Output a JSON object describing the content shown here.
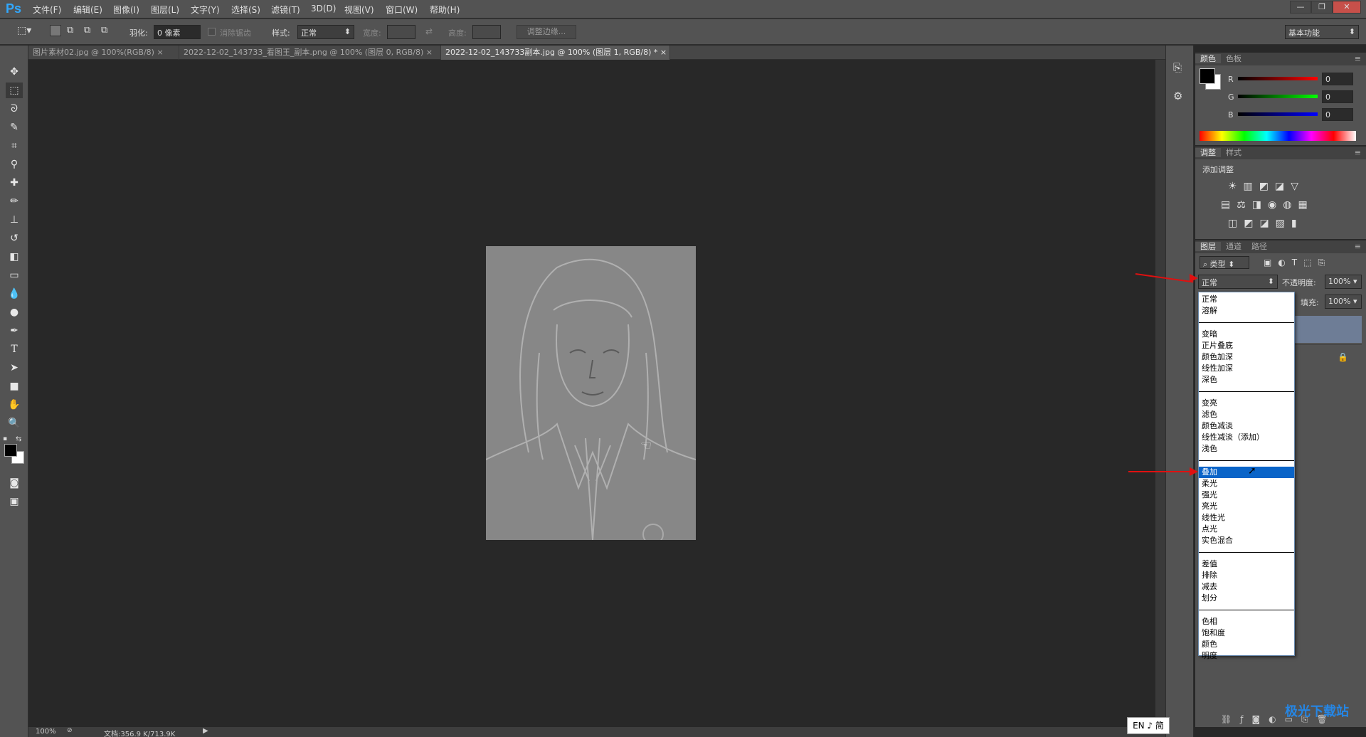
{
  "app": {
    "logo": "Ps"
  },
  "menu": [
    "文件(F)",
    "编辑(E)",
    "图像(I)",
    "图层(L)",
    "文字(Y)",
    "选择(S)",
    "滤镜(T)",
    "3D(D)",
    "视图(V)",
    "窗口(W)",
    "帮助(H)"
  ],
  "options": {
    "feather_label": "羽化:",
    "feather_value": "0 像素",
    "antialias_label": "消除锯齿",
    "style_label": "样式:",
    "style_value": "正常",
    "width_label": "宽度:",
    "height_label": "高度:",
    "refine_edge": "调整边缘...",
    "workspace": "基本功能"
  },
  "tabs": [
    {
      "label": "图片素材02.jpg @ 100%(RGB/8)",
      "close": "×"
    },
    {
      "label": "2022-12-02_143733_看图王_副本.png @ 100% (图层 0, RGB/8)",
      "close": "×"
    },
    {
      "label": "2022-12-02_143733副本.jpg @ 100% (图层 1, RGB/8) *",
      "close": "×"
    }
  ],
  "status": {
    "zoom": "100%",
    "doc": "文档:356.9 K/713.9K"
  },
  "color_panel": {
    "tabs": [
      "颜色",
      "色板"
    ],
    "channels": [
      {
        "label": "R",
        "value": "0"
      },
      {
        "label": "G",
        "value": "0"
      },
      {
        "label": "B",
        "value": "0"
      }
    ]
  },
  "adjust_panel": {
    "tabs": [
      "调整",
      "样式"
    ],
    "title": "添加调整"
  },
  "layers_panel": {
    "tabs": [
      "图层",
      "通道",
      "路径"
    ],
    "kind": "类型",
    "blend_mode": "正常",
    "opacity_label": "不透明度:",
    "opacity_value": "100%",
    "fill_label": "填充:",
    "fill_value": "100%"
  },
  "blend_groups": [
    [
      "正常",
      "溶解"
    ],
    [
      "变暗",
      "正片叠底",
      "颜色加深",
      "线性加深",
      "深色"
    ],
    [
      "变亮",
      "滤色",
      "颜色减淡",
      "线性减淡（添加）",
      "浅色"
    ],
    [
      "叠加",
      "柔光",
      "强光",
      "亮光",
      "线性光",
      "点光",
      "实色混合"
    ],
    [
      "差值",
      "排除",
      "减去",
      "划分"
    ],
    [
      "色相",
      "饱和度",
      "颜色",
      "明度"
    ]
  ],
  "selected_blend": "叠加",
  "ime": "EN ♪ 简",
  "watermark": "极光下载站"
}
